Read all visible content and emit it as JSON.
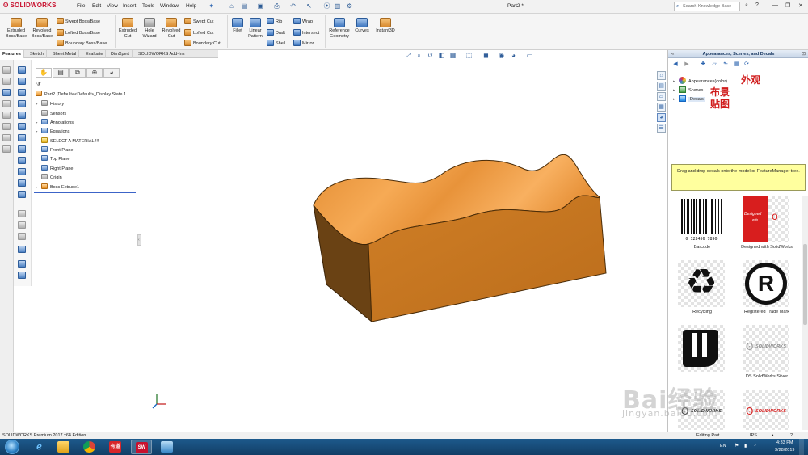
{
  "app": {
    "logo": "SOLIDWORKS",
    "menus": [
      "File",
      "Edit",
      "View",
      "Insert",
      "Tools",
      "Window",
      "Help"
    ],
    "doc_title": "Part2 *",
    "search_placeholder": "Search Knowledge Base"
  },
  "ribbon": {
    "extruded_boss": "Extruded\nBoss/Base",
    "revolved_boss": "Revolved\nBoss/Base",
    "swept_boss": "Swept Boss/Base",
    "lofted_boss": "Lofted Boss/Base",
    "boundary_boss": "Boundary Boss/Base",
    "extruded_cut": "Extruded\nCut",
    "hole_wizard": "Hole\nWizard",
    "revolved_cut": "Revolved\nCut",
    "swept_cut": "Swept Cut",
    "lofted_cut": "Lofted Cut",
    "boundary_cut": "Boundary Cut",
    "fillet": "Fillet",
    "linear_pattern": "Linear\nPattern",
    "rib": "Rib",
    "draft": "Draft",
    "shell": "Shell",
    "wrap": "Wrap",
    "intersect": "Intersect",
    "mirror": "Mirror",
    "reference_geometry": "Reference\nGeometry",
    "curves": "Curves",
    "instant3d": "Instant3D"
  },
  "tabs": [
    "Features",
    "Sketch",
    "Sheet Metal",
    "Evaluate",
    "DimXpert",
    "SOLIDWORKS Add-Ins"
  ],
  "feature_tree": {
    "root": "Part2  (Default<<Default>_Display State 1",
    "items": [
      {
        "label": "History",
        "expandable": true
      },
      {
        "label": "Sensors",
        "expandable": false
      },
      {
        "label": "Annotations",
        "expandable": true
      },
      {
        "label": "Equations",
        "expandable": true
      },
      {
        "label": "SELECT A MATERIAL !!!",
        "expandable": false
      },
      {
        "label": "Front Plane",
        "expandable": false
      },
      {
        "label": "Top Plane",
        "expandable": false
      },
      {
        "label": "Right Plane",
        "expandable": false
      },
      {
        "label": "Origin",
        "expandable": false
      },
      {
        "label": "Boss-Extrude1",
        "expandable": true
      }
    ]
  },
  "taskpane": {
    "title": "Appearances, Scenes, and Decals",
    "tree": [
      "Appearances(color)",
      "Scenes",
      "Decals"
    ],
    "annotations": [
      "外观",
      "布景",
      "贴图"
    ],
    "hint": "Drag and drop decals onto the model or FeatureManager tree.",
    "decals": [
      "Barcode",
      "Designed with SolidWorks",
      "Recycling",
      "Registered Trade Mark",
      "",
      "DS SolidWorks Silver",
      "",
      ""
    ],
    "decal_texts": {
      "designed_main": "Designed",
      "designed_sub": "with",
      "registered_symbol": "R",
      "ds_logo": "SOLIDWORKS",
      "barcode_number": "0 123456 7890"
    }
  },
  "watermark": {
    "main": "Bai经验",
    "sub": "jingyan.baidu.com"
  },
  "status": {
    "edition": "SOLIDWORKS Premium 2017 x64 Edition",
    "mode": "Editing Part",
    "units": "IPS"
  },
  "taskbar": {
    "lang": "EN",
    "time": "4:33 PM",
    "date": "3/28/2019",
    "youdao": "有道",
    "solidworks_glyph": "SW"
  },
  "colors": {
    "accent": "#c8102e",
    "part_top": "#f3a24c",
    "part_front": "#c4741f",
    "part_side": "#6e4413",
    "annotation": "#d01c1c"
  }
}
